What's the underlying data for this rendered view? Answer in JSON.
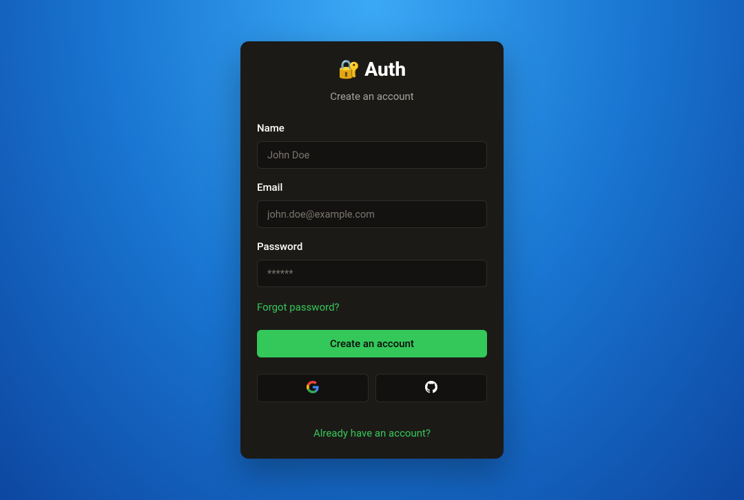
{
  "header": {
    "lock_emoji": "🔐",
    "title": "Auth",
    "subtitle": "Create an account"
  },
  "form": {
    "name": {
      "label": "Name",
      "placeholder": "John Doe"
    },
    "email": {
      "label": "Email",
      "placeholder": "john.doe@example.com"
    },
    "password": {
      "label": "Password",
      "placeholder": "******"
    },
    "forgot_label": "Forgot password?",
    "submit_label": "Create an account"
  },
  "oauth": {
    "google_name": "google-icon",
    "github_name": "github-icon"
  },
  "footer": {
    "already_label": "Already have an account?"
  },
  "colors": {
    "accent": "#34c759",
    "card_bg": "#1c1a17",
    "input_bg": "#141210"
  }
}
